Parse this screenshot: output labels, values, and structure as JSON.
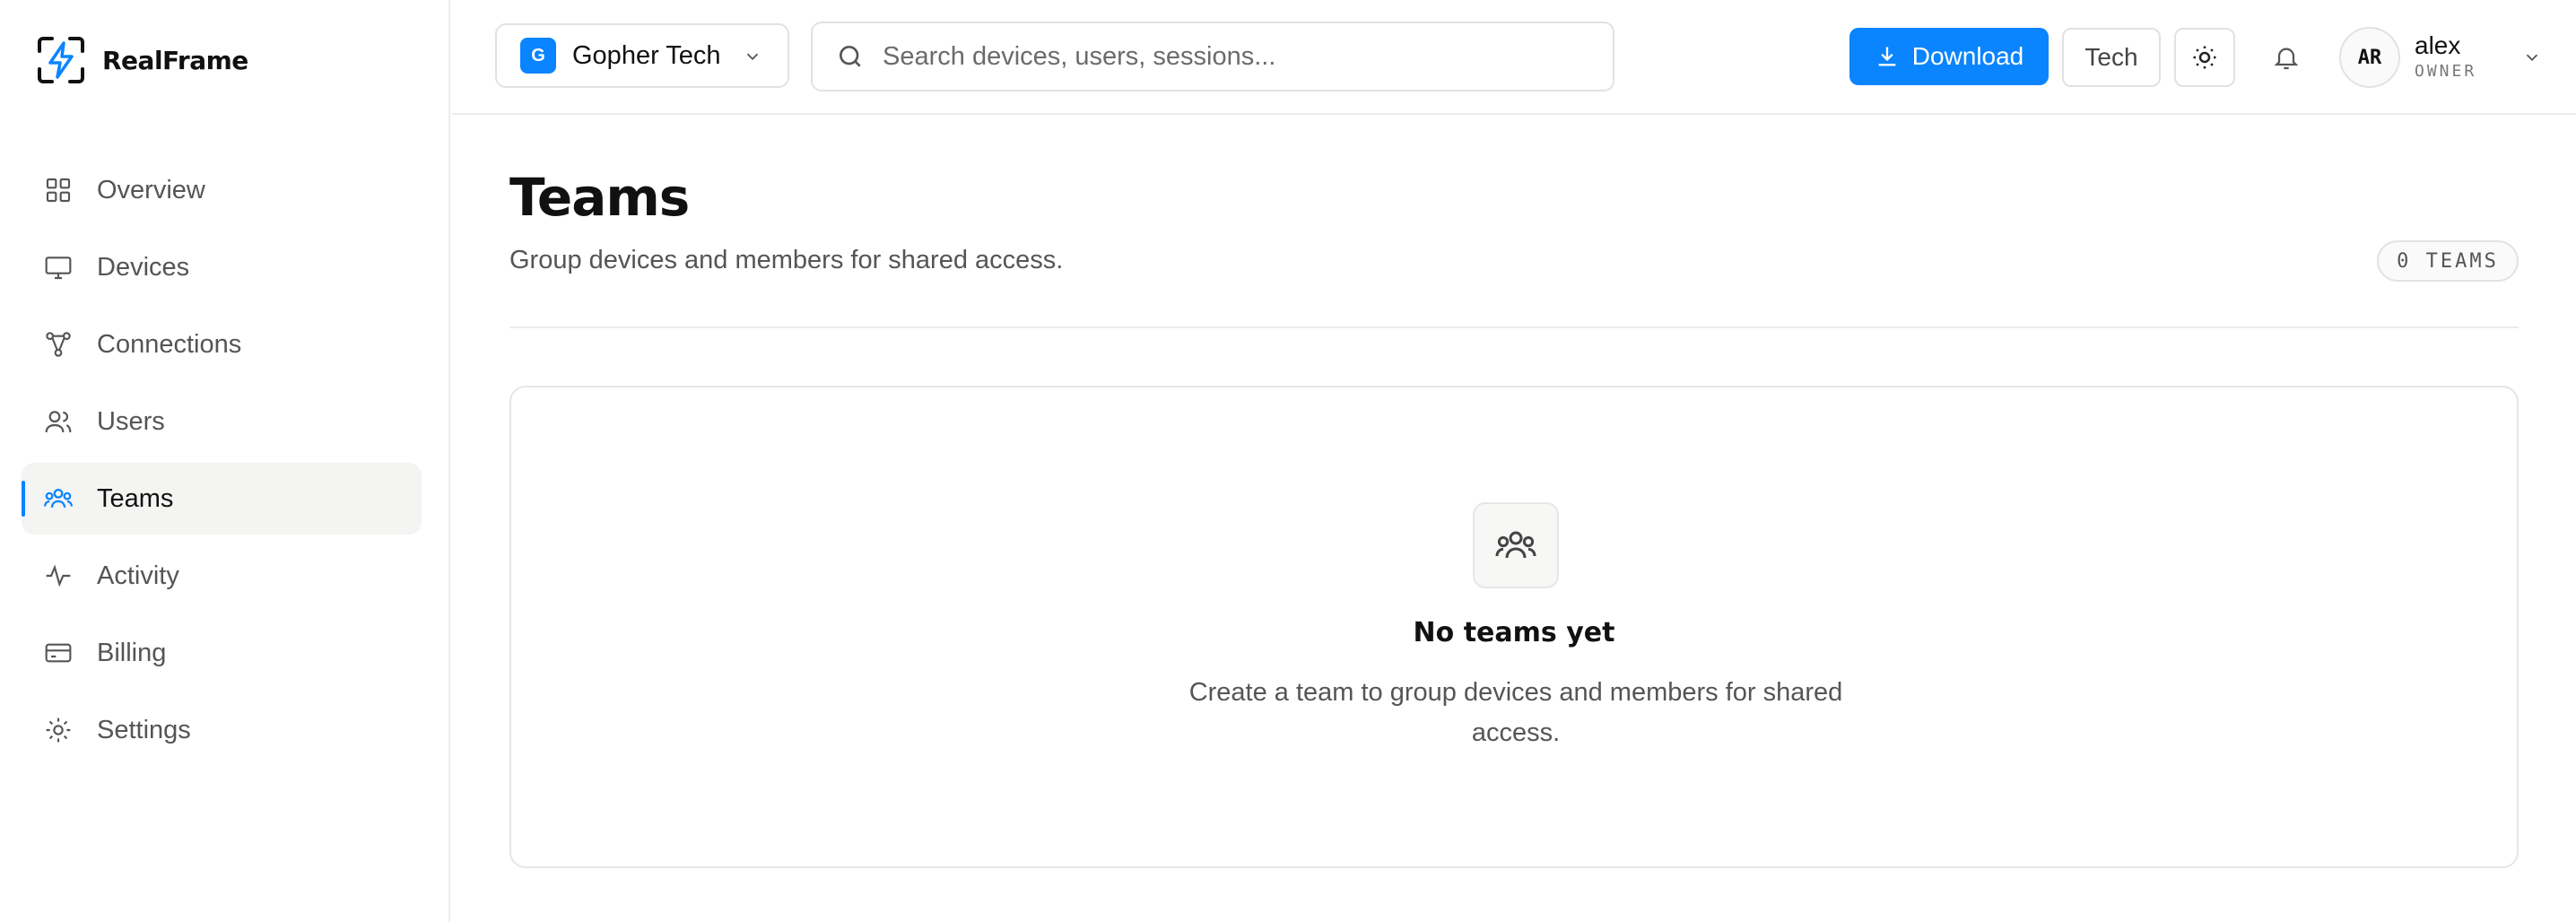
{
  "brand": {
    "name": "RealFrame",
    "logo_icon": "lightning-bolt-icon"
  },
  "sidebar": {
    "items": [
      {
        "label": "Overview",
        "icon": "grid-icon",
        "active": false
      },
      {
        "label": "Devices",
        "icon": "monitor-icon",
        "active": false
      },
      {
        "label": "Connections",
        "icon": "network-icon",
        "active": false
      },
      {
        "label": "Users",
        "icon": "user-icon",
        "active": false
      },
      {
        "label": "Teams",
        "icon": "team-icon",
        "active": true
      },
      {
        "label": "Activity",
        "icon": "pulse-icon",
        "active": false
      },
      {
        "label": "Billing",
        "icon": "credit-card-icon",
        "active": false
      },
      {
        "label": "Settings",
        "icon": "gear-icon",
        "active": false
      }
    ]
  },
  "topbar": {
    "org": {
      "initial": "G",
      "name": "Gopher Tech"
    },
    "search": {
      "placeholder": "Search devices, users, sessions...",
      "value": ""
    },
    "download_label": "Download",
    "tech_label": "Tech",
    "user": {
      "initials": "AR",
      "name": "alex",
      "role": "OWNER"
    }
  },
  "page": {
    "title": "Teams",
    "subtitle": "Group devices and members for shared access.",
    "count_badge": "0 TEAMS"
  },
  "empty_state": {
    "title": "No teams yet",
    "description": "Create a team to group devices and members for shared access."
  },
  "colors": {
    "accent": "#0a84ff",
    "border": "#e2e2e2",
    "active_bg": "#f4f4f3",
    "muted_text": "#555555"
  }
}
